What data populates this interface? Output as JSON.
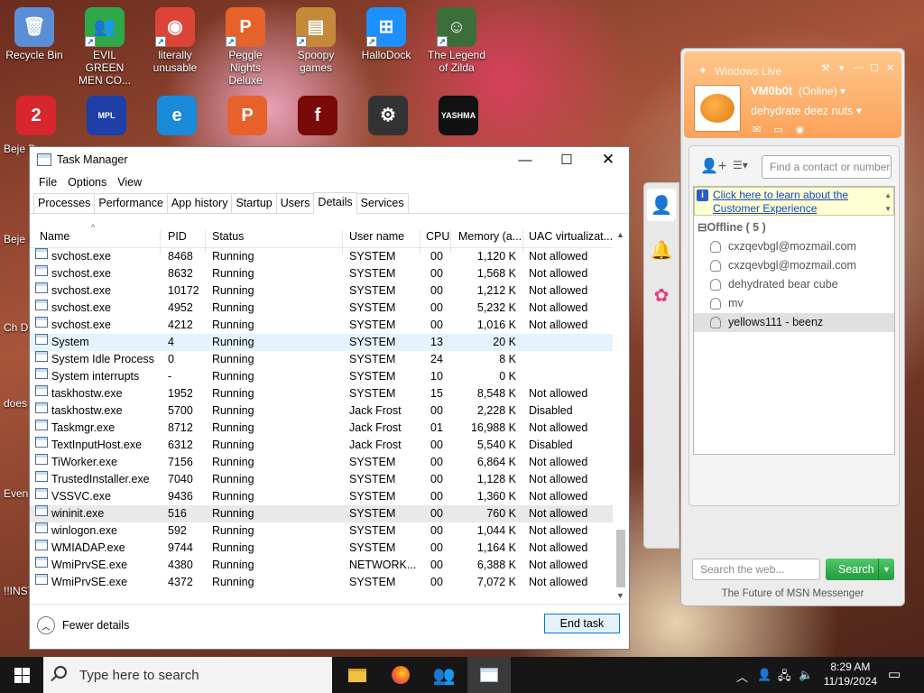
{
  "desktop": {
    "icons": [
      {
        "label": "Recycle Bin",
        "color": "#5a8fd8",
        "glyph": "🗑"
      },
      {
        "label": "EVIL GREEN MEN CO...",
        "color": "#2fa84a",
        "glyph": "👥"
      },
      {
        "label": "literally unusable",
        "color": "#db4437",
        "glyph": "◉"
      },
      {
        "label": "Peggle Nights Deluxe",
        "color": "#e7622a",
        "glyph": "P"
      },
      {
        "label": "Spoopy games",
        "color": "#c48a3a",
        "glyph": "▤"
      },
      {
        "label": "HalloDock",
        "color": "#1e90ff",
        "glyph": "⊞"
      },
      {
        "label": "The Legend of Zilda",
        "color": "#3c6e3c",
        "glyph": "☺"
      }
    ],
    "icons_row2": [
      {
        "color": "#d8262e",
        "glyph": "2"
      },
      {
        "color": "#1e3ea8",
        "glyph": "MPL"
      },
      {
        "color": "#1a8bd8",
        "glyph": "e"
      },
      {
        "color": "#e7622a",
        "glyph": "P"
      },
      {
        "color": "#7a0a0a",
        "glyph": "f"
      },
      {
        "color": "#333333",
        "glyph": "⚙"
      },
      {
        "color": "#111111",
        "glyph": "YASHMA"
      }
    ],
    "edge_labels": [
      "Beje De",
      "Beje De",
      "Ch De",
      "does",
      "Even",
      "!!INST"
    ]
  },
  "taskmgr": {
    "title": "Task Manager",
    "menu": [
      "File",
      "Options",
      "View"
    ],
    "tabs": [
      "Processes",
      "Performance",
      "App history",
      "Startup",
      "Users",
      "Details",
      "Services"
    ],
    "active_tab": "Details",
    "columns": [
      "Name",
      "PID",
      "Status",
      "User name",
      "CPU",
      "Memory (a...",
      "UAC virtualizat..."
    ],
    "rows": [
      {
        "name": "svchost.exe",
        "pid": "8468",
        "status": "Running",
        "user": "SYSTEM",
        "cpu": "00",
        "mem": "1,120 K",
        "uac": "Not allowed"
      },
      {
        "name": "svchost.exe",
        "pid": "8632",
        "status": "Running",
        "user": "SYSTEM",
        "cpu": "00",
        "mem": "1,568 K",
        "uac": "Not allowed"
      },
      {
        "name": "svchost.exe",
        "pid": "10172",
        "status": "Running",
        "user": "SYSTEM",
        "cpu": "00",
        "mem": "1,212 K",
        "uac": "Not allowed"
      },
      {
        "name": "svchost.exe",
        "pid": "4952",
        "status": "Running",
        "user": "SYSTEM",
        "cpu": "00",
        "mem": "5,232 K",
        "uac": "Not allowed"
      },
      {
        "name": "svchost.exe",
        "pid": "4212",
        "status": "Running",
        "user": "SYSTEM",
        "cpu": "00",
        "mem": "1,016 K",
        "uac": "Not allowed"
      },
      {
        "name": "System",
        "pid": "4",
        "status": "Running",
        "user": "SYSTEM",
        "cpu": "13",
        "mem": "20 K",
        "uac": ""
      },
      {
        "name": "System Idle Process",
        "pid": "0",
        "status": "Running",
        "user": "SYSTEM",
        "cpu": "24",
        "mem": "8 K",
        "uac": ""
      },
      {
        "name": "System interrupts",
        "pid": "-",
        "status": "Running",
        "user": "SYSTEM",
        "cpu": "10",
        "mem": "0 K",
        "uac": ""
      },
      {
        "name": "taskhostw.exe",
        "pid": "1952",
        "status": "Running",
        "user": "SYSTEM",
        "cpu": "15",
        "mem": "8,548 K",
        "uac": "Not allowed"
      },
      {
        "name": "taskhostw.exe",
        "pid": "5700",
        "status": "Running",
        "user": "Jack Frost",
        "cpu": "00",
        "mem": "2,228 K",
        "uac": "Disabled"
      },
      {
        "name": "Taskmgr.exe",
        "pid": "8712",
        "status": "Running",
        "user": "Jack Frost",
        "cpu": "01",
        "mem": "16,988 K",
        "uac": "Not allowed"
      },
      {
        "name": "TextInputHost.exe",
        "pid": "6312",
        "status": "Running",
        "user": "Jack Frost",
        "cpu": "00",
        "mem": "5,540 K",
        "uac": "Disabled"
      },
      {
        "name": "TiWorker.exe",
        "pid": "7156",
        "status": "Running",
        "user": "SYSTEM",
        "cpu": "00",
        "mem": "6,864 K",
        "uac": "Not allowed"
      },
      {
        "name": "TrustedInstaller.exe",
        "pid": "7040",
        "status": "Running",
        "user": "SYSTEM",
        "cpu": "00",
        "mem": "1,128 K",
        "uac": "Not allowed"
      },
      {
        "name": "VSSVC.exe",
        "pid": "9436",
        "status": "Running",
        "user": "SYSTEM",
        "cpu": "00",
        "mem": "1,360 K",
        "uac": "Not allowed"
      },
      {
        "name": "wininit.exe",
        "pid": "516",
        "status": "Running",
        "user": "SYSTEM",
        "cpu": "00",
        "mem": "760 K",
        "uac": "Not allowed"
      },
      {
        "name": "winlogon.exe",
        "pid": "592",
        "status": "Running",
        "user": "SYSTEM",
        "cpu": "00",
        "mem": "1,044 K",
        "uac": "Not allowed"
      },
      {
        "name": "WMIADAP.exe",
        "pid": "9744",
        "status": "Running",
        "user": "SYSTEM",
        "cpu": "00",
        "mem": "1,164 K",
        "uac": "Not allowed"
      },
      {
        "name": "WmiPrvSE.exe",
        "pid": "4380",
        "status": "Running",
        "user": "NETWORK...",
        "cpu": "00",
        "mem": "6,388 K",
        "uac": "Not allowed"
      },
      {
        "name": "WmiPrvSE.exe",
        "pid": "4372",
        "status": "Running",
        "user": "SYSTEM",
        "cpu": "00",
        "mem": "7,072 K",
        "uac": "Not allowed"
      }
    ],
    "hover_row": 5,
    "selected_row": 15,
    "fewer_details": "Fewer details",
    "end_task": "End task"
  },
  "msn": {
    "title": "Windows Live",
    "username": "VM0b0t",
    "status": "(Online)",
    "personal_message": "dehydrate deez nuts",
    "find_placeholder": "Find a contact or number",
    "info_text": "Click here to learn about the Customer Experience",
    "group": "Offline ( 5 )",
    "contacts": [
      "cxzqevbgl@mozmail.com",
      "cxzqevbgl@mozmail.com",
      "dehydrated bear cube",
      "mv",
      "yellows111 - beenz"
    ],
    "selected_contact": 4,
    "search_placeholder": "Search the web...",
    "search_button": "Search",
    "tagline": "The Future of MSN Messenger"
  },
  "taskbar": {
    "search_placeholder": "Type here to search",
    "time": "8:29 AM",
    "date": "11/19/2024"
  }
}
